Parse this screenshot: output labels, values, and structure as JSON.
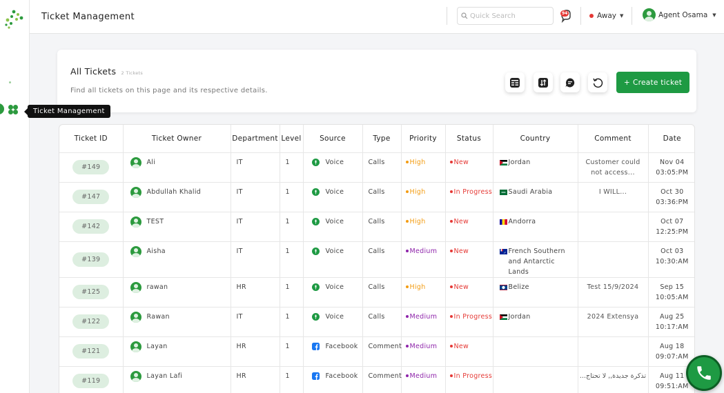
{
  "header": {
    "title": "Ticket Management",
    "search_placeholder": "Quick Search",
    "notification_count": "94",
    "status_label": "Away",
    "status_color": "#e53935",
    "user_name": "Agent Osama"
  },
  "sidebar": {
    "tooltip": "Ticket Management"
  },
  "hero": {
    "title": "All Tickets",
    "count_label": "2 Tickets",
    "subtitle": "Find all tickets on this page and its respective details.",
    "create_label": "Create ticket",
    "tools": [
      "table-view-icon",
      "sort-icon",
      "chat-search-icon",
      "refresh-icon"
    ]
  },
  "colors": {
    "brand_green": "#1e9a43",
    "high": "#f39c12",
    "medium": "#8e24aa",
    "red": "#e53935"
  },
  "table": {
    "columns": [
      "Ticket ID",
      "Ticket Owner",
      "Department",
      "Level",
      "Source",
      "Type",
      "Priority",
      "Status",
      "Country",
      "Comment",
      "Date"
    ],
    "rows": [
      {
        "id": "#149",
        "owner": "Ali",
        "dept": "IT",
        "level": "1",
        "source": "Voice",
        "source_icon": "voice-icon",
        "type": "Calls",
        "priority": "High",
        "status": "New",
        "country": "Jordan",
        "flag": "jordan-flag",
        "comment": "Customer could not access...",
        "date": "Nov 04",
        "time": "03:05:PM"
      },
      {
        "id": "#147",
        "owner": "Abdullah Khalid",
        "dept": "IT",
        "level": "1",
        "source": "Voice",
        "source_icon": "voice-icon",
        "type": "Calls",
        "priority": "High",
        "status": "In Progress",
        "country": "Saudi Arabia",
        "flag": "saudi-flag",
        "comment": "I WILL...",
        "date": "Oct 30",
        "time": "03:36:PM"
      },
      {
        "id": "#142",
        "owner": "TEST",
        "dept": "IT",
        "level": "1",
        "source": "Voice",
        "source_icon": "voice-icon",
        "type": "Calls",
        "priority": "High",
        "status": "New",
        "country": "Andorra",
        "flag": "andorra-flag",
        "comment": "",
        "date": "Oct 07",
        "time": "12:25:PM"
      },
      {
        "id": "#139",
        "owner": "Aisha",
        "dept": "IT",
        "level": "1",
        "source": "Voice",
        "source_icon": "voice-icon",
        "type": "Calls",
        "priority": "Medium",
        "status": "New",
        "country": "French Southern and Antarctic Lands",
        "flag": "tf-flag",
        "comment": "",
        "date": "Oct 03",
        "time": "10:30:AM"
      },
      {
        "id": "#125",
        "owner": "rawan",
        "dept": "HR",
        "level": "1",
        "source": "Voice",
        "source_icon": "voice-icon",
        "type": "Calls",
        "priority": "High",
        "status": "New",
        "country": "Belize",
        "flag": "belize-flag",
        "comment": "Test 15/9/2024",
        "date": "Sep 15",
        "time": "10:05:AM"
      },
      {
        "id": "#122",
        "owner": "Rawan",
        "dept": "IT",
        "level": "1",
        "source": "Voice",
        "source_icon": "voice-icon",
        "type": "Calls",
        "priority": "Medium",
        "status": "In Progress",
        "country": "Jordan",
        "flag": "jordan-flag",
        "comment": "2024 Extensya",
        "date": "Aug 25",
        "time": "10:17:AM"
      },
      {
        "id": "#121",
        "owner": "Layan",
        "dept": "HR",
        "level": "1",
        "source": "Facebook",
        "source_icon": "facebook-icon",
        "type": "Comment",
        "priority": "Medium",
        "status": "New",
        "country": "",
        "flag": "",
        "comment": "",
        "date": "Aug 18",
        "time": "09:07:AM"
      },
      {
        "id": "#119",
        "owner": "Layan Lafi",
        "dept": "HR",
        "level": "1",
        "source": "Facebook",
        "source_icon": "facebook-icon",
        "type": "Comment",
        "priority": "Medium",
        "status": "In Progress",
        "country": "",
        "flag": "",
        "comment": "...تذكرة جديدة,, لا تحتاج",
        "date": "Aug 11",
        "time": "09:51:AM"
      }
    ]
  }
}
